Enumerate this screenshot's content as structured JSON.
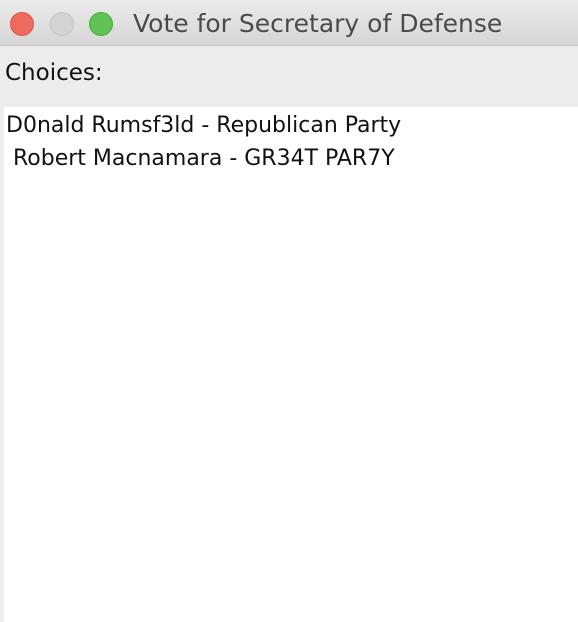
{
  "window": {
    "title": "Vote for Secretary of Defense"
  },
  "choices_label": "Choices:",
  "choices": [
    "D0nald Rumsf3ld - Republican Party",
    " Robert Macnamara - GR34T PAR7Y"
  ]
}
